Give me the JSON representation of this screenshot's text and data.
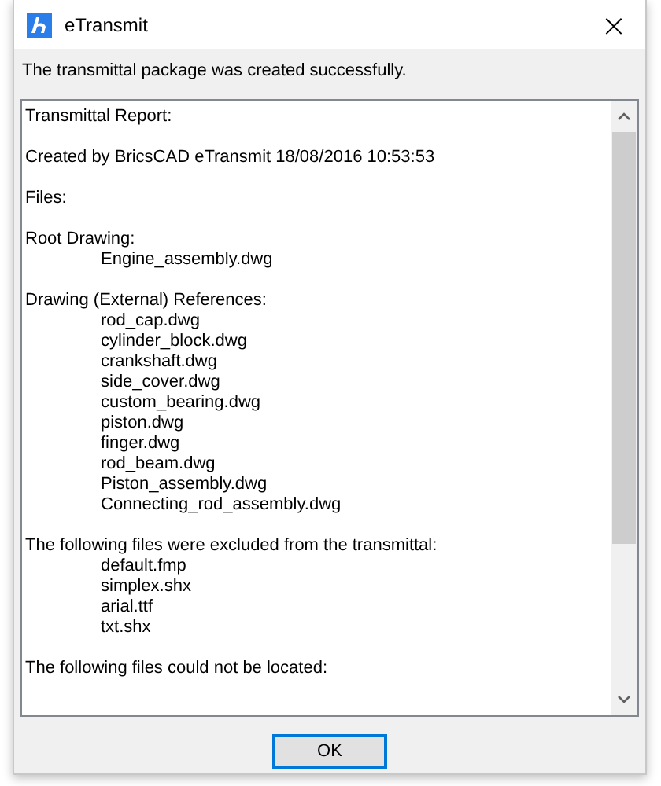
{
  "window": {
    "title": "eTransmit",
    "close": "×"
  },
  "message": "The transmittal package was created successfully.",
  "report": [
    {
      "heading": "Transmittal Report:"
    },
    {
      "heading": "Created by BricsCAD eTransmit 18/08/2016 10:53:53"
    },
    {
      "heading": "Files:"
    },
    {
      "heading": "Root Drawing:",
      "files": [
        "Engine_assembly.dwg"
      ]
    },
    {
      "heading": "Drawing (External) References:",
      "files": [
        "rod_cap.dwg",
        "cylinder_block.dwg",
        "crankshaft.dwg",
        "side_cover.dwg",
        "custom_bearing.dwg",
        "piston.dwg",
        "finger.dwg",
        "rod_beam.dwg",
        "Piston_assembly.dwg",
        "Connecting_rod_assembly.dwg"
      ]
    },
    {
      "heading": "The following files were excluded from the transmittal:",
      "files": [
        "default.fmp",
        "simplex.shx",
        "arial.ttf",
        "txt.shx"
      ]
    },
    {
      "heading": "The following files could not be located:"
    }
  ],
  "buttons": [
    "OK"
  ]
}
